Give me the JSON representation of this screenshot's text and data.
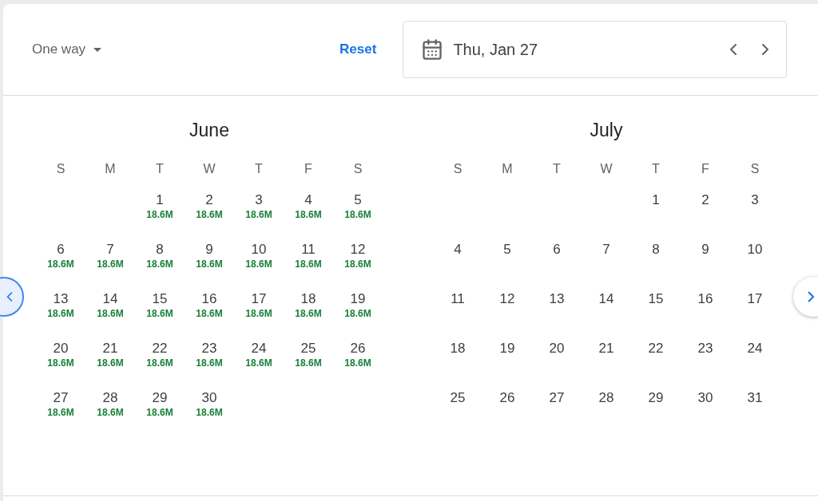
{
  "trip_type": {
    "label": "One way"
  },
  "reset": {
    "label": "Reset"
  },
  "date_field": {
    "value": "Thu, Jan 27"
  },
  "months": [
    {
      "name": "June",
      "weekdays": [
        "S",
        "M",
        "T",
        "W",
        "T",
        "F",
        "S"
      ],
      "weeks": [
        {
          "starts_late": true,
          "days": [
            {
              "day": "1",
              "price": "18.6M"
            },
            {
              "day": "2",
              "price": "18.6M"
            },
            {
              "day": "3",
              "price": "18.6M"
            },
            {
              "day": "4",
              "price": "18.6M"
            },
            {
              "day": "5",
              "price": "18.6M"
            }
          ]
        },
        [
          {
            "day": "6",
            "price": "18.6M"
          },
          {
            "day": "7",
            "price": "18.6M"
          },
          {
            "day": "8",
            "price": "18.6M"
          },
          {
            "day": "9",
            "price": "18.6M"
          },
          {
            "day": "10",
            "price": "18.6M"
          },
          {
            "day": "11",
            "price": "18.6M"
          },
          {
            "day": "12",
            "price": "18.6M"
          }
        ],
        [
          {
            "day": "13",
            "price": "18.6M"
          },
          {
            "day": "14",
            "price": "18.6M"
          },
          {
            "day": "15",
            "price": "18.6M"
          },
          {
            "day": "16",
            "price": "18.6M"
          },
          {
            "day": "17",
            "price": "18.6M"
          },
          {
            "day": "18",
            "price": "18.6M"
          },
          {
            "day": "19",
            "price": "18.6M"
          }
        ],
        [
          {
            "day": "20",
            "price": "18.6M"
          },
          {
            "day": "21",
            "price": "18.6M"
          },
          {
            "day": "22",
            "price": "18.6M"
          },
          {
            "day": "23",
            "price": "18.6M"
          },
          {
            "day": "24",
            "price": "18.6M"
          },
          {
            "day": "25",
            "price": "18.6M"
          },
          {
            "day": "26",
            "price": "18.6M"
          }
        ],
        {
          "starts_late": false,
          "days": [
            {
              "day": "27",
              "price": "18.6M"
            },
            {
              "day": "28",
              "price": "18.6M"
            },
            {
              "day": "29",
              "price": "18.6M"
            },
            {
              "day": "30",
              "price": "18.6M"
            }
          ]
        }
      ]
    },
    {
      "name": "July",
      "weekdays": [
        "S",
        "M",
        "T",
        "W",
        "T",
        "F",
        "S"
      ],
      "weeks": [
        {
          "starts_late": true,
          "days": [
            {
              "day": "1"
            },
            {
              "day": "2"
            },
            {
              "day": "3"
            }
          ]
        },
        [
          {
            "day": "4"
          },
          {
            "day": "5"
          },
          {
            "day": "6"
          },
          {
            "day": "7"
          },
          {
            "day": "8"
          },
          {
            "day": "9"
          },
          {
            "day": "10"
          }
        ],
        [
          {
            "day": "11"
          },
          {
            "day": "12"
          },
          {
            "day": "13"
          },
          {
            "day": "14"
          },
          {
            "day": "15"
          },
          {
            "day": "16"
          },
          {
            "day": "17"
          }
        ],
        [
          {
            "day": "18"
          },
          {
            "day": "19"
          },
          {
            "day": "20"
          },
          {
            "day": "21"
          },
          {
            "day": "22"
          },
          {
            "day": "23"
          },
          {
            "day": "24"
          }
        ],
        [
          {
            "day": "25"
          },
          {
            "day": "26"
          },
          {
            "day": "27"
          },
          {
            "day": "28"
          },
          {
            "day": "29"
          },
          {
            "day": "30"
          },
          {
            "day": "31"
          }
        ]
      ]
    }
  ]
}
